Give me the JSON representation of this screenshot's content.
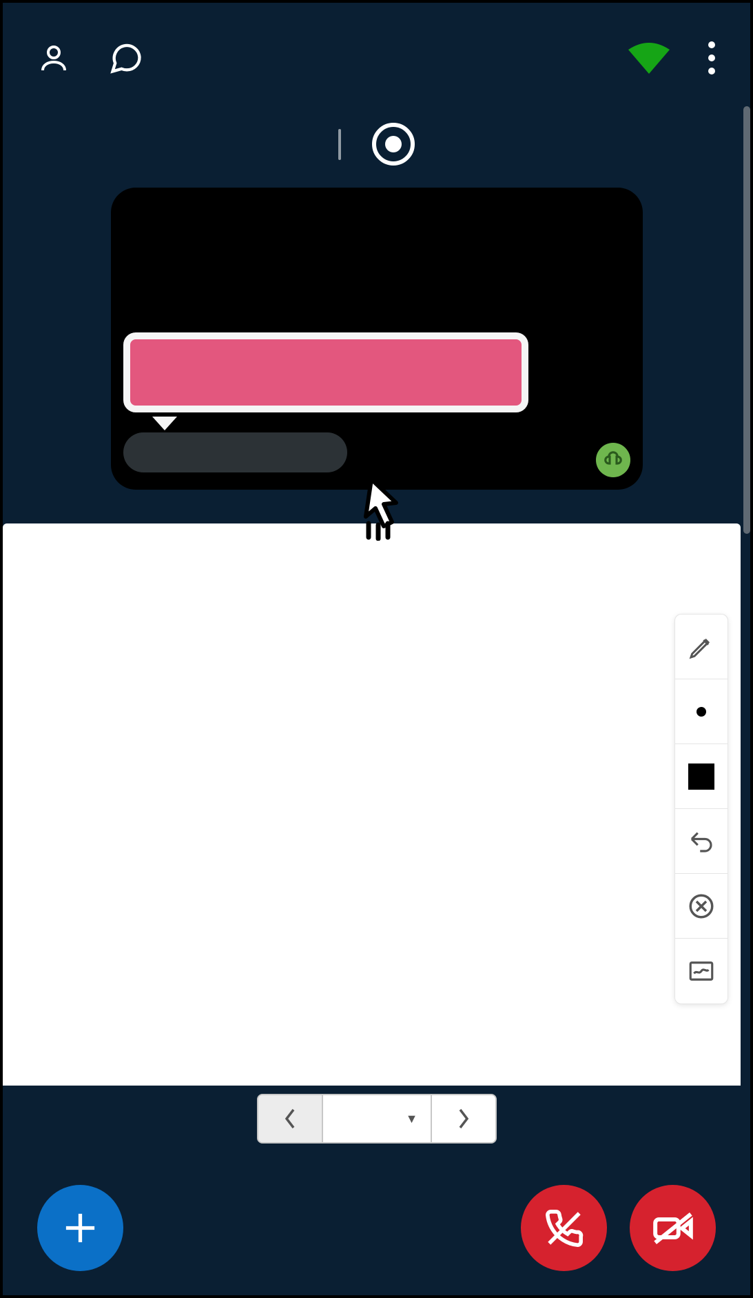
{
  "topbar": {
    "icons": {
      "users": "users-icon",
      "chat": "chat-icon",
      "wifi": "wifi-icon",
      "more": "more-icon"
    },
    "connection_color": "#16a516"
  },
  "recording": {
    "label": ""
  },
  "video_tile": {
    "bubble_text": "",
    "name_label": "",
    "audio_color": "#6fb64e"
  },
  "tool_panel": {
    "items": [
      {
        "name": "pencil"
      },
      {
        "name": "thickness-small"
      },
      {
        "name": "color-black"
      },
      {
        "name": "undo"
      },
      {
        "name": "clear"
      },
      {
        "name": "presentation"
      }
    ]
  },
  "pager": {
    "prev": "prev",
    "next": "next",
    "select_label": ""
  },
  "actions": {
    "add": "add",
    "end_call": "end-call",
    "camera_off": "camera-off"
  }
}
